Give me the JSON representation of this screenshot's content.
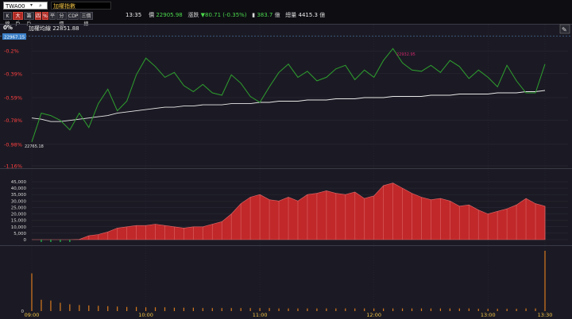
{
  "toolbar": {
    "symbol_code": "TWA00",
    "symbol_name": "加權指數",
    "buttons": [
      {
        "label": "K線",
        "active": false
      },
      {
        "label": "大戶",
        "active": true
      },
      {
        "label": "籌戶",
        "active": false
      },
      {
        "label": "四",
        "active": true
      },
      {
        "label": "%",
        "active": true
      },
      {
        "label": "平",
        "active": false
      },
      {
        "label": "分價",
        "active": false
      },
      {
        "label": "CDP",
        "active": false
      },
      {
        "label": "三價線",
        "active": false
      }
    ]
  },
  "quote": {
    "time": "13:35",
    "price_label": "價",
    "price": "22905.98",
    "change_label": "漲跌",
    "change": "▼80.71 (-0.35%)",
    "volume_icon": "bar-icon",
    "volume": "383.7",
    "volume_unit": "億",
    "total_label": "總量",
    "total": "4415.3",
    "total_unit": "億"
  },
  "price_panel": {
    "legend_text": "加權均線 22851.88",
    "top_pct": "0%",
    "ref_badge": "22967.15",
    "y_ticks": [
      "-0.2%",
      "-0.39%",
      "-0.59%",
      "-0.78%",
      "-0.98%",
      "-1.16%"
    ],
    "high_label": "22932.95",
    "low_label": "22765.18",
    "edit_icon": "pencil-icon"
  },
  "volume_panel": {
    "y_ticks": [
      "45,000",
      "40,000",
      "35,000",
      "30,000",
      "25,000",
      "20,000",
      "15,000",
      "10,000",
      "5,000",
      "0"
    ]
  },
  "lower_panel": {
    "y_tick": "0"
  },
  "x_axis": {
    "ticks": [
      "09:00",
      "10:00",
      "11:00",
      "12:00",
      "13:00",
      "13:30"
    ]
  },
  "colors": {
    "price_line": "#2ea02e",
    "avg_line": "#e8e8e8",
    "volume_fill": "#c0282a",
    "volume_up": "#e06a6a",
    "volume_down": "#26a84a",
    "lower_bars": "#d87a1e"
  },
  "chart_data": [
    {
      "type": "line",
      "title": "",
      "legend": [
        "加權均線 22851.88"
      ],
      "x": [
        "09:00",
        "09:05",
        "09:10",
        "09:15",
        "09:20",
        "09:25",
        "09:30",
        "09:35",
        "09:40",
        "09:45",
        "09:50",
        "09:55",
        "10:00",
        "10:05",
        "10:10",
        "10:15",
        "10:20",
        "10:25",
        "10:30",
        "10:35",
        "10:40",
        "10:45",
        "10:50",
        "10:55",
        "11:00",
        "11:05",
        "11:10",
        "11:15",
        "11:20",
        "11:25",
        "11:30",
        "11:35",
        "11:40",
        "11:45",
        "11:50",
        "11:55",
        "12:00",
        "12:05",
        "12:10",
        "12:15",
        "12:20",
        "12:25",
        "12:30",
        "12:35",
        "12:40",
        "12:45",
        "12:50",
        "12:55",
        "13:00",
        "13:05",
        "13:10",
        "13:15",
        "13:20",
        "13:25",
        "13:30"
      ],
      "series": [
        {
          "name": "",
          "values": [
            -0.96,
            -0.72,
            -0.74,
            -0.78,
            -0.86,
            -0.72,
            -0.84,
            -0.64,
            -0.52,
            -0.7,
            -0.62,
            -0.4,
            -0.26,
            -0.33,
            -0.42,
            -0.38,
            -0.49,
            -0.54,
            -0.48,
            -0.55,
            -0.57,
            -0.4,
            -0.47,
            -0.58,
            -0.63,
            -0.5,
            -0.38,
            -0.31,
            -0.42,
            -0.37,
            -0.45,
            -0.42,
            -0.35,
            -0.32,
            -0.44,
            -0.36,
            -0.42,
            -0.28,
            -0.18,
            -0.3,
            -0.36,
            -0.37,
            -0.32,
            -0.38,
            -0.28,
            -0.33,
            -0.43,
            -0.36,
            -0.42,
            -0.5,
            -0.32,
            -0.45,
            -0.55,
            -0.55,
            -0.31
          ]
        },
        {
          "name": "加權均線 22851.88",
          "values": [
            -0.76,
            -0.77,
            -0.79,
            -0.79,
            -0.78,
            -0.77,
            -0.76,
            -0.75,
            -0.74,
            -0.72,
            -0.71,
            -0.7,
            -0.69,
            -0.68,
            -0.67,
            -0.67,
            -0.66,
            -0.66,
            -0.65,
            -0.65,
            -0.65,
            -0.64,
            -0.64,
            -0.64,
            -0.63,
            -0.63,
            -0.62,
            -0.62,
            -0.62,
            -0.61,
            -0.61,
            -0.61,
            -0.6,
            -0.6,
            -0.6,
            -0.59,
            -0.59,
            -0.59,
            -0.58,
            -0.58,
            -0.58,
            -0.58,
            -0.57,
            -0.57,
            -0.57,
            -0.56,
            -0.56,
            -0.56,
            -0.56,
            -0.55,
            -0.55,
            -0.55,
            -0.54,
            -0.54,
            -0.53
          ]
        }
      ],
      "ylim": [
        -1.16,
        0
      ],
      "high": 22932.95,
      "low": 22765.18
    },
    {
      "type": "area",
      "title": "",
      "x": [
        "09:00",
        "09:05",
        "09:10",
        "09:15",
        "09:20",
        "09:25",
        "09:30",
        "09:35",
        "09:40",
        "09:45",
        "09:50",
        "09:55",
        "10:00",
        "10:05",
        "10:10",
        "10:15",
        "10:20",
        "10:25",
        "10:30",
        "10:35",
        "10:40",
        "10:45",
        "10:50",
        "10:55",
        "11:00",
        "11:05",
        "11:10",
        "11:15",
        "11:20",
        "11:25",
        "11:30",
        "11:35",
        "11:40",
        "11:45",
        "11:50",
        "11:55",
        "12:00",
        "12:05",
        "12:10",
        "12:15",
        "12:20",
        "12:25",
        "12:30",
        "12:35",
        "12:40",
        "12:45",
        "12:50",
        "12:55",
        "13:00",
        "13:05",
        "13:10",
        "13:15",
        "13:20",
        "13:25",
        "13:30"
      ],
      "values": [
        0,
        -500,
        -1500,
        -200,
        -1200,
        200,
        3000,
        4000,
        6000,
        9000,
        10000,
        11000,
        11000,
        12000,
        11000,
        10000,
        9000,
        10000,
        10000,
        12000,
        14000,
        20000,
        28000,
        33000,
        35000,
        31000,
        30000,
        33000,
        30000,
        35000,
        36000,
        38000,
        36000,
        35000,
        37000,
        32000,
        34000,
        42000,
        44000,
        40000,
        36000,
        33000,
        31000,
        32000,
        30000,
        26000,
        27000,
        23000,
        20000,
        22000,
        24000,
        27000,
        32000,
        28000,
        26000
      ],
      "ylim": [
        0,
        45000
      ]
    },
    {
      "type": "bar",
      "title": "",
      "x": [
        "09:00",
        "09:05",
        "09:10",
        "09:15",
        "09:20",
        "09:25",
        "09:30",
        "09:35",
        "09:40",
        "09:45",
        "09:50",
        "09:55",
        "10:00",
        "10:05",
        "10:10",
        "10:15",
        "10:20",
        "10:25",
        "10:30",
        "10:35",
        "10:40",
        "10:45",
        "10:50",
        "10:55",
        "11:00",
        "11:05",
        "11:10",
        "11:15",
        "11:20",
        "11:25",
        "11:30",
        "11:35",
        "11:40",
        "11:45",
        "11:50",
        "11:55",
        "12:00",
        "12:05",
        "12:10",
        "12:15",
        "12:20",
        "12:25",
        "12:30",
        "12:35",
        "12:40",
        "12:45",
        "12:50",
        "12:55",
        "13:00",
        "13:05",
        "13:10",
        "13:15",
        "13:20",
        "13:25",
        "13:30"
      ],
      "values": [
        100,
        30,
        28,
        22,
        18,
        16,
        15,
        14,
        13,
        12,
        11,
        11,
        10,
        10,
        10,
        9,
        9,
        9,
        8,
        8,
        8,
        8,
        8,
        8,
        8,
        8,
        7,
        7,
        7,
        7,
        7,
        7,
        7,
        7,
        7,
        7,
        7,
        7,
        7,
        7,
        7,
        7,
        7,
        7,
        7,
        7,
        7,
        6,
        6,
        6,
        6,
        6,
        7,
        7,
        160
      ]
    }
  ]
}
